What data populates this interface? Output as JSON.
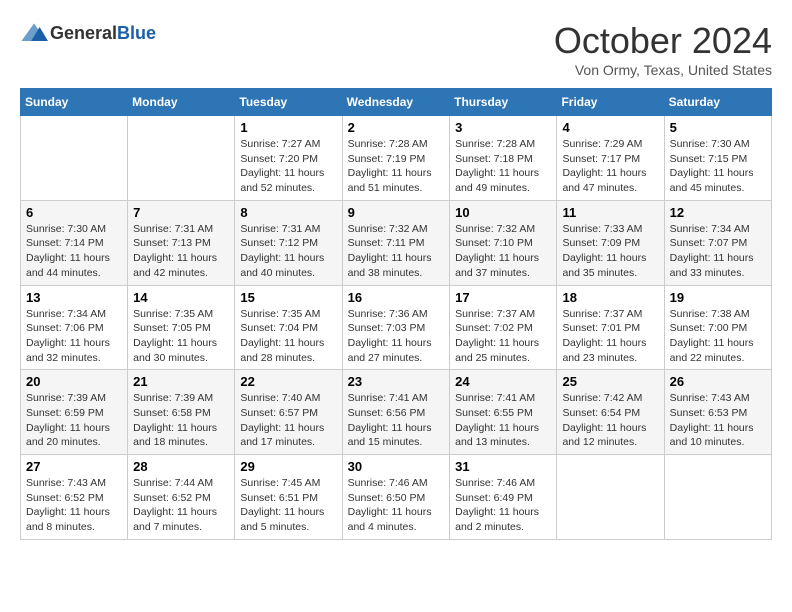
{
  "header": {
    "logo_line1": "General",
    "logo_line2": "Blue",
    "month": "October 2024",
    "location": "Von Ormy, Texas, United States"
  },
  "days_of_week": [
    "Sunday",
    "Monday",
    "Tuesday",
    "Wednesday",
    "Thursday",
    "Friday",
    "Saturday"
  ],
  "weeks": [
    [
      {
        "day": "",
        "content": ""
      },
      {
        "day": "",
        "content": ""
      },
      {
        "day": "1",
        "content": "Sunrise: 7:27 AM\nSunset: 7:20 PM\nDaylight: 11 hours and 52 minutes."
      },
      {
        "day": "2",
        "content": "Sunrise: 7:28 AM\nSunset: 7:19 PM\nDaylight: 11 hours and 51 minutes."
      },
      {
        "day": "3",
        "content": "Sunrise: 7:28 AM\nSunset: 7:18 PM\nDaylight: 11 hours and 49 minutes."
      },
      {
        "day": "4",
        "content": "Sunrise: 7:29 AM\nSunset: 7:17 PM\nDaylight: 11 hours and 47 minutes."
      },
      {
        "day": "5",
        "content": "Sunrise: 7:30 AM\nSunset: 7:15 PM\nDaylight: 11 hours and 45 minutes."
      }
    ],
    [
      {
        "day": "6",
        "content": "Sunrise: 7:30 AM\nSunset: 7:14 PM\nDaylight: 11 hours and 44 minutes."
      },
      {
        "day": "7",
        "content": "Sunrise: 7:31 AM\nSunset: 7:13 PM\nDaylight: 11 hours and 42 minutes."
      },
      {
        "day": "8",
        "content": "Sunrise: 7:31 AM\nSunset: 7:12 PM\nDaylight: 11 hours and 40 minutes."
      },
      {
        "day": "9",
        "content": "Sunrise: 7:32 AM\nSunset: 7:11 PM\nDaylight: 11 hours and 38 minutes."
      },
      {
        "day": "10",
        "content": "Sunrise: 7:32 AM\nSunset: 7:10 PM\nDaylight: 11 hours and 37 minutes."
      },
      {
        "day": "11",
        "content": "Sunrise: 7:33 AM\nSunset: 7:09 PM\nDaylight: 11 hours and 35 minutes."
      },
      {
        "day": "12",
        "content": "Sunrise: 7:34 AM\nSunset: 7:07 PM\nDaylight: 11 hours and 33 minutes."
      }
    ],
    [
      {
        "day": "13",
        "content": "Sunrise: 7:34 AM\nSunset: 7:06 PM\nDaylight: 11 hours and 32 minutes."
      },
      {
        "day": "14",
        "content": "Sunrise: 7:35 AM\nSunset: 7:05 PM\nDaylight: 11 hours and 30 minutes."
      },
      {
        "day": "15",
        "content": "Sunrise: 7:35 AM\nSunset: 7:04 PM\nDaylight: 11 hours and 28 minutes."
      },
      {
        "day": "16",
        "content": "Sunrise: 7:36 AM\nSunset: 7:03 PM\nDaylight: 11 hours and 27 minutes."
      },
      {
        "day": "17",
        "content": "Sunrise: 7:37 AM\nSunset: 7:02 PM\nDaylight: 11 hours and 25 minutes."
      },
      {
        "day": "18",
        "content": "Sunrise: 7:37 AM\nSunset: 7:01 PM\nDaylight: 11 hours and 23 minutes."
      },
      {
        "day": "19",
        "content": "Sunrise: 7:38 AM\nSunset: 7:00 PM\nDaylight: 11 hours and 22 minutes."
      }
    ],
    [
      {
        "day": "20",
        "content": "Sunrise: 7:39 AM\nSunset: 6:59 PM\nDaylight: 11 hours and 20 minutes."
      },
      {
        "day": "21",
        "content": "Sunrise: 7:39 AM\nSunset: 6:58 PM\nDaylight: 11 hours and 18 minutes."
      },
      {
        "day": "22",
        "content": "Sunrise: 7:40 AM\nSunset: 6:57 PM\nDaylight: 11 hours and 17 minutes."
      },
      {
        "day": "23",
        "content": "Sunrise: 7:41 AM\nSunset: 6:56 PM\nDaylight: 11 hours and 15 minutes."
      },
      {
        "day": "24",
        "content": "Sunrise: 7:41 AM\nSunset: 6:55 PM\nDaylight: 11 hours and 13 minutes."
      },
      {
        "day": "25",
        "content": "Sunrise: 7:42 AM\nSunset: 6:54 PM\nDaylight: 11 hours and 12 minutes."
      },
      {
        "day": "26",
        "content": "Sunrise: 7:43 AM\nSunset: 6:53 PM\nDaylight: 11 hours and 10 minutes."
      }
    ],
    [
      {
        "day": "27",
        "content": "Sunrise: 7:43 AM\nSunset: 6:52 PM\nDaylight: 11 hours and 8 minutes."
      },
      {
        "day": "28",
        "content": "Sunrise: 7:44 AM\nSunset: 6:52 PM\nDaylight: 11 hours and 7 minutes."
      },
      {
        "day": "29",
        "content": "Sunrise: 7:45 AM\nSunset: 6:51 PM\nDaylight: 11 hours and 5 minutes."
      },
      {
        "day": "30",
        "content": "Sunrise: 7:46 AM\nSunset: 6:50 PM\nDaylight: 11 hours and 4 minutes."
      },
      {
        "day": "31",
        "content": "Sunrise: 7:46 AM\nSunset: 6:49 PM\nDaylight: 11 hours and 2 minutes."
      },
      {
        "day": "",
        "content": ""
      },
      {
        "day": "",
        "content": ""
      }
    ]
  ]
}
